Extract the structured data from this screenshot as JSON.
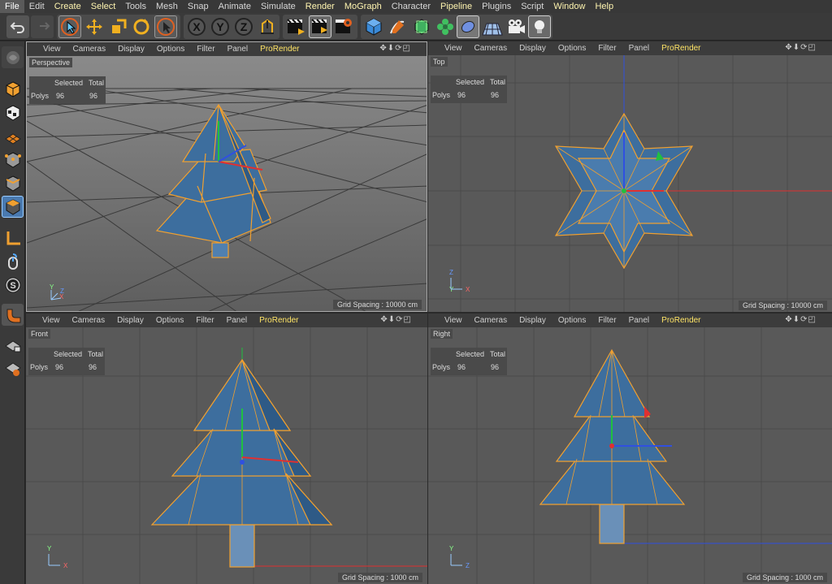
{
  "menu": [
    "File",
    "Edit",
    "Create",
    "Select",
    "Tools",
    "Mesh",
    "Snap",
    "Animate",
    "Simulate",
    "Render",
    "MoGraph",
    "Character",
    "Pipeline",
    "Plugins",
    "Script",
    "Window",
    "Help"
  ],
  "viewport_menu": {
    "view": "View",
    "cameras": "Cameras",
    "display": "Display",
    "options": "Options",
    "filter": "Filter",
    "panel": "Panel",
    "prorender": "ProRender"
  },
  "hud": {
    "selected": "Selected",
    "total": "Total",
    "row_label": "Polys",
    "selected_val": "96",
    "total_val": "96"
  },
  "viewports": {
    "perspective": {
      "label": "Perspective",
      "grid": "Grid Spacing : 10000 cm"
    },
    "top": {
      "label": "Top",
      "grid": "Grid Spacing : 10000 cm"
    },
    "front": {
      "label": "Front",
      "grid": "Grid Spacing : 1000 cm"
    },
    "right": {
      "label": "Right",
      "grid": "Grid Spacing : 1000 cm"
    }
  },
  "axes": {
    "x": "X",
    "y": "Y",
    "z": "Z"
  },
  "toolbar_icons": [
    "undo-icon",
    "redo-icon",
    "live-selection-icon",
    "move-icon",
    "scale-icon",
    "rotate-icon",
    "recent-tool-icon",
    "x-axis-lock-icon",
    "y-axis-lock-icon",
    "z-axis-lock-icon",
    "coordinate-system-icon",
    "render-view-icon",
    "render-picture-viewer-icon",
    "render-settings-icon",
    "cube-primitive-icon",
    "pen-spline-icon",
    "subdivision-icon",
    "mograph-cloner-icon",
    "deformer-icon",
    "floor-icon",
    "camera-icon",
    "light-icon"
  ],
  "colors": {
    "accent_yellow": "#ffe566",
    "tree_fill": "#3d6e9e",
    "tree_edge": "#f0a030"
  }
}
